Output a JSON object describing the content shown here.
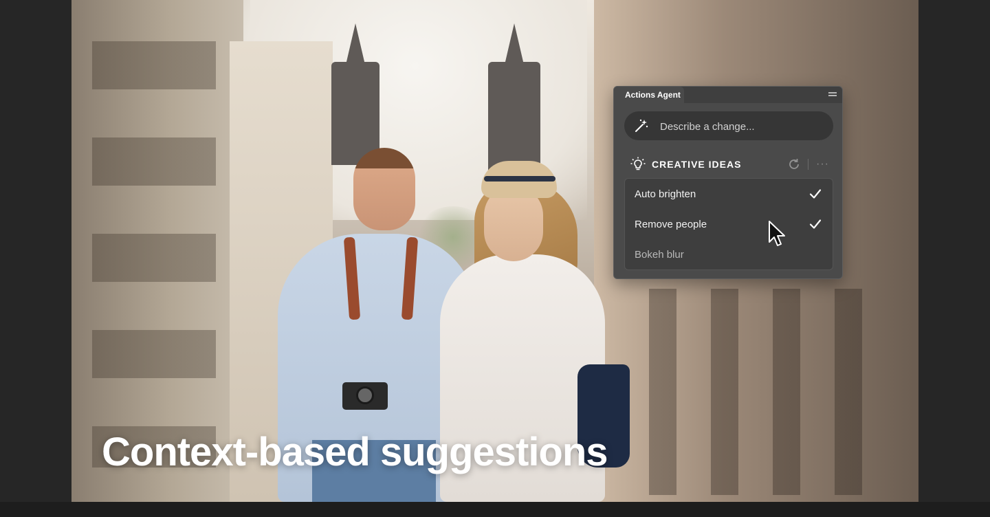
{
  "panel": {
    "title": "Actions Agent",
    "prompt_placeholder": "Describe a change...",
    "section_title": "CREATIVE IDEAS",
    "more_label": "···",
    "ideas": [
      {
        "label": "Auto brighten",
        "checked": true
      },
      {
        "label": "Remove people",
        "checked": true
      },
      {
        "label": "Bokeh blur",
        "checked": false
      }
    ]
  },
  "caption": "Context-based suggestions",
  "colors": {
    "panel_bg": "#4a4a4a",
    "list_bg": "#3e3e3e",
    "input_bg": "#363636",
    "text": "#ffffff"
  },
  "icons": [
    "magic-wand-icon",
    "lightbulb-icon",
    "refresh-icon",
    "more-icon",
    "checkmark-icon",
    "menu-icon",
    "mouse-cursor-icon"
  ]
}
